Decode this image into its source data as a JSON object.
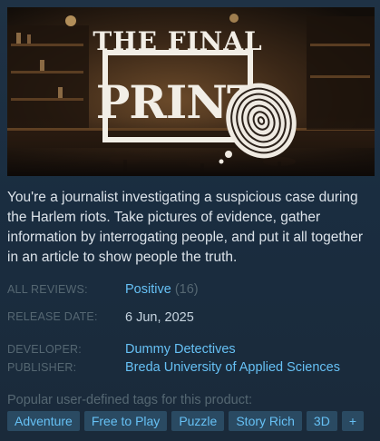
{
  "capsule": {
    "logo_line1": "THE FINAL",
    "logo_line2": "PRINT"
  },
  "description": "You're a journalist investigating a suspicious case during the Harlem riots. Take pictures of evidence, gather information by interrogating people, and put it all together in an article to show people the truth.",
  "reviews": {
    "label": "ALL REVIEWS:",
    "summary": "Positive",
    "count": "(16)"
  },
  "release": {
    "label": "RELEASE DATE:",
    "date": "6 Jun, 2025"
  },
  "developer": {
    "label": "DEVELOPER:",
    "name": "Dummy Detectives"
  },
  "publisher": {
    "label": "PUBLISHER:",
    "name": "Breda University of Applied Sciences"
  },
  "tags": {
    "title": "Popular user-defined tags for this product:",
    "items": [
      "Adventure",
      "Free to Play",
      "Puzzle",
      "Story Rich",
      "3D"
    ],
    "more": "+"
  },
  "colors": {
    "link": "#66c0f4",
    "label": "#556772",
    "tag_bg": "#2a4a62",
    "background": "#1b2838"
  }
}
